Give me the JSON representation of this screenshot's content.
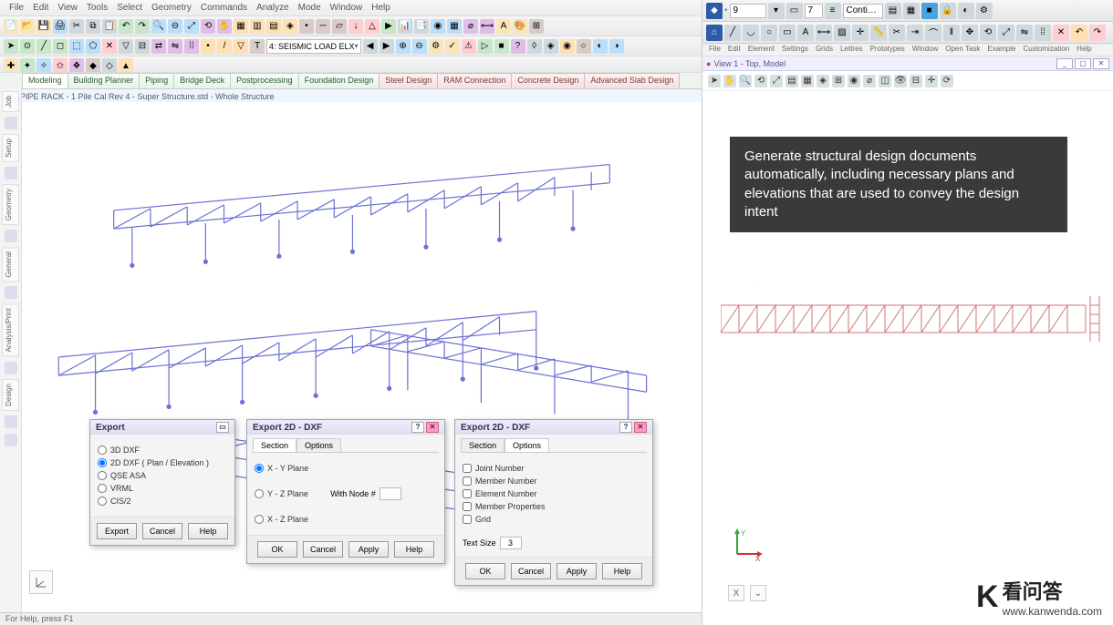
{
  "left": {
    "menu": [
      "File",
      "Edit",
      "View",
      "Tools",
      "Select",
      "Geometry",
      "Commands",
      "Analyze",
      "Mode",
      "Window",
      "Help"
    ],
    "load_combo": "4: SEISMIC LOAD ELX",
    "tabs": [
      {
        "label": "Modeling",
        "active": true,
        "alt": false
      },
      {
        "label": "Building Planner",
        "alt": false
      },
      {
        "label": "Piping",
        "alt": false
      },
      {
        "label": "Bridge Deck",
        "alt": false
      },
      {
        "label": "Postprocessing",
        "alt": false
      },
      {
        "label": "Foundation Design",
        "alt": false
      },
      {
        "label": "Steel Design",
        "alt": true
      },
      {
        "label": "RAM Connection",
        "alt": true
      },
      {
        "label": "Concrete Design",
        "alt": true
      },
      {
        "label": "Advanced Slab Design",
        "alt": true
      }
    ],
    "doc_title": "PIPE RACK - 1 Pile Cal Rev 4 - Super Structure.std - Whole Structure",
    "side_tabs": [
      "Job",
      "Setup",
      "Geometry",
      "General",
      "Analysis/Print",
      "Design"
    ],
    "status": "For Help, press F1"
  },
  "dlg_export": {
    "title": "Export",
    "options": [
      {
        "label": "3D DXF",
        "checked": false
      },
      {
        "label": "2D DXF ( Plan / Elevation )",
        "checked": true
      },
      {
        "label": "QSE ASA",
        "checked": false
      },
      {
        "label": "VRML",
        "checked": false
      },
      {
        "label": "CIS/2",
        "checked": false
      }
    ],
    "buttons": {
      "export": "Export",
      "cancel": "Cancel",
      "help": "Help"
    }
  },
  "dlg_2d_a": {
    "title": "Export 2D - DXF",
    "tabs": {
      "section": "Section",
      "options": "Options"
    },
    "planes": [
      {
        "label": "X - Y Plane",
        "checked": true
      },
      {
        "label": "Y - Z Plane",
        "checked": false
      },
      {
        "label": "X - Z Plane",
        "checked": false
      }
    ],
    "node_label": "With Node #",
    "buttons": {
      "ok": "OK",
      "cancel": "Cancel",
      "apply": "Apply",
      "help": "Help"
    }
  },
  "dlg_2d_b": {
    "title": "Export 2D - DXF",
    "tabs": {
      "section": "Section",
      "options": "Options"
    },
    "checks": [
      {
        "label": "Joint Number",
        "checked": false
      },
      {
        "label": "Member Number",
        "checked": false
      },
      {
        "label": "Element Number",
        "checked": false
      },
      {
        "label": "Member Properties",
        "checked": false
      },
      {
        "label": "Grid",
        "checked": false
      }
    ],
    "text_size_label": "Text Size",
    "text_size_value": "3",
    "buttons": {
      "ok": "OK",
      "cancel": "Cancel",
      "apply": "Apply",
      "help": "Help"
    }
  },
  "right": {
    "num_field": "9",
    "combo_label": "Conti…",
    "menu": [
      "File",
      "Edit",
      "Element",
      "Settings",
      "Grids",
      "Lettres",
      "Prototypes",
      "Window",
      "Open Task",
      "Example",
      "Customization",
      "Help"
    ],
    "view_title": "View 1 - Top, Model",
    "caption": "Generate structural design documents automatically, including necessary plans and elevations that are used to convey the design intent",
    "axis": {
      "x": "X",
      "y": "Y"
    },
    "bottom": {
      "a": "X",
      "b": "⌄"
    }
  },
  "watermark": {
    "logo": "K",
    "title": "看问答",
    "url": "www.kanwenda.com"
  }
}
